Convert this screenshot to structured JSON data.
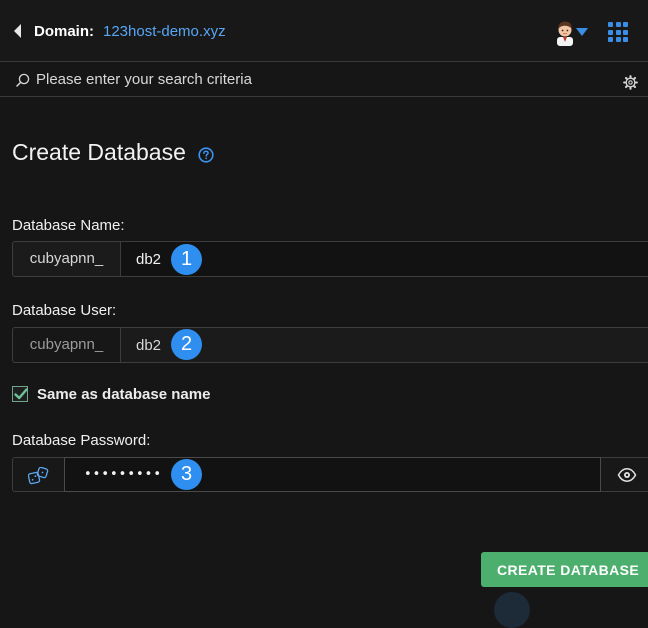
{
  "header": {
    "domain_label": "Domain:",
    "domain_value": "123host-demo.xyz",
    "back_icon": "caret-left-icon",
    "avatar_icon": "user-avatar-icon",
    "avatar_caret_icon": "caret-down-icon",
    "apps_icon": "grid-icon"
  },
  "search": {
    "placeholder": "Please enter your search criteria",
    "value": "",
    "icon": "search-icon",
    "settings_icon": "gear-icon"
  },
  "page": {
    "title": "Create Database",
    "help_icon": "question-circle-icon"
  },
  "form": {
    "db_name": {
      "label": "Database Name:",
      "prefix": "cubyapnn_",
      "value": "db2",
      "step": "1"
    },
    "db_user": {
      "label": "Database User:",
      "prefix": "cubyapnn_",
      "value": "db2",
      "step": "2"
    },
    "same_as_name": {
      "label": "Same as database name",
      "checked": true
    },
    "db_password": {
      "label": "Database Password:",
      "value": "•••••••••",
      "step": "3",
      "generate_icon": "dice-icon",
      "reveal_icon": "eye-icon"
    },
    "submit_label": "CREATE DATABASE"
  },
  "colors": {
    "accent": "#57a6f5",
    "badge": "#2e8ff0",
    "primary_button": "#4caf6d",
    "background": "#161616"
  }
}
